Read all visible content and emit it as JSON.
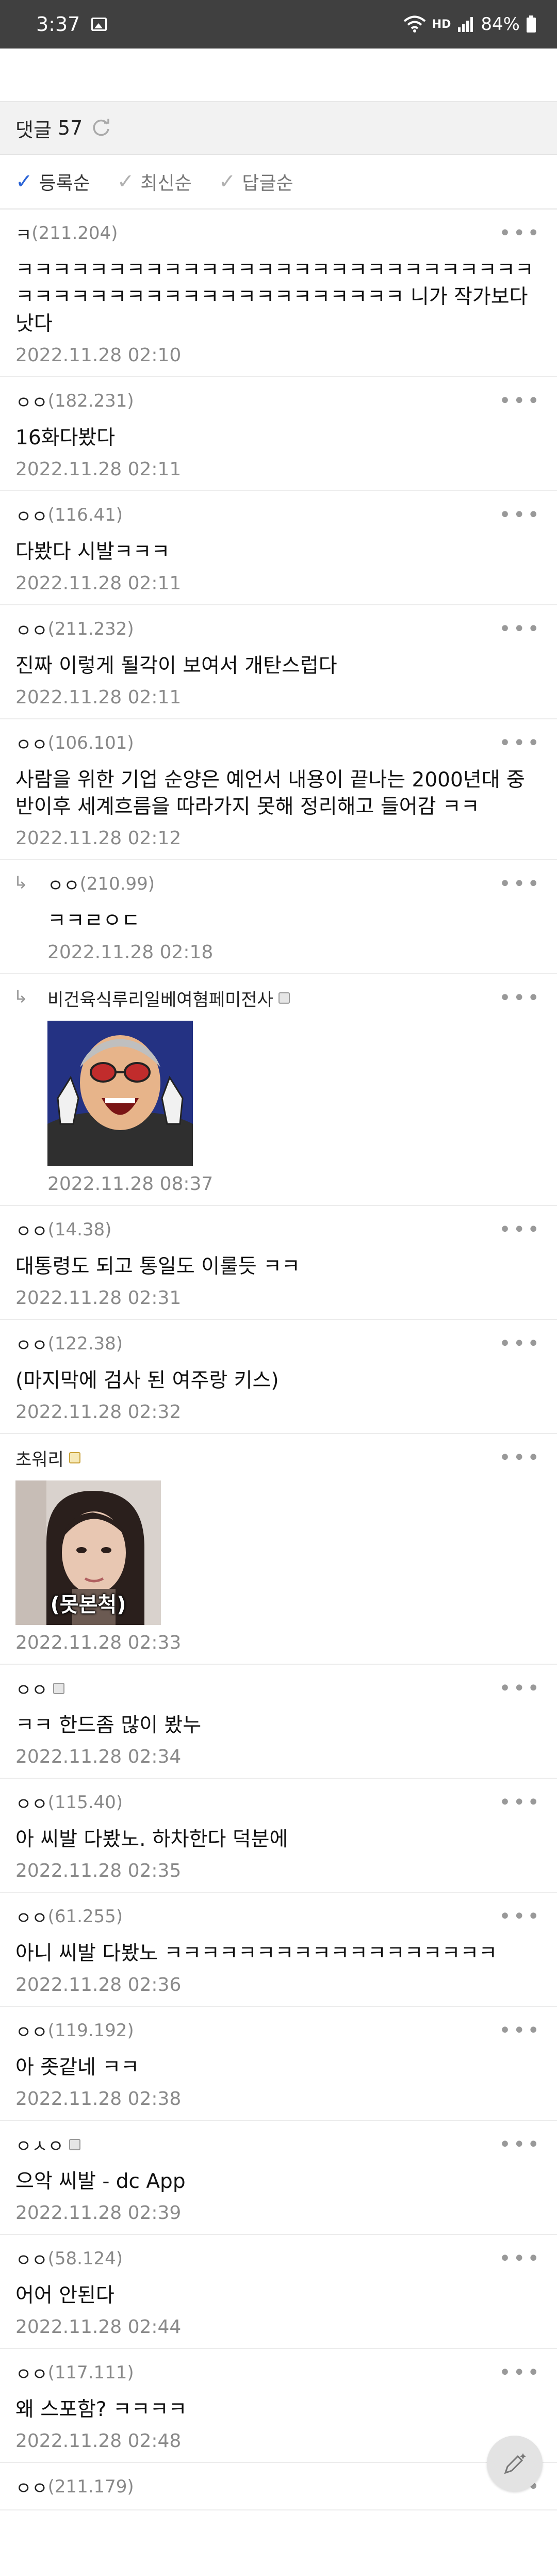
{
  "status_bar": {
    "time": "3:37",
    "network": "HD",
    "battery": "84%"
  },
  "comment_header": {
    "label": "댓글",
    "count": "57"
  },
  "sort_tabs": [
    {
      "label": "등록순",
      "active": true
    },
    {
      "label": "최신순",
      "active": false
    },
    {
      "label": "답글순",
      "active": false
    }
  ],
  "comments": [
    {
      "nick": "ㅋ",
      "ip": "(211.204)",
      "text": "ㅋㅋㅋㅋㅋㅋㅋㅋㅋㅋㅋㅋㅋㅋㅋㅋㅋㅋㅋㅋㅋㅋㅋㅋㅋㅋㅋㅋㅋㅋㅋㅋㅋㅋㅋㅋㅋㅋㅋㅋㅋㅋㅋㅋㅋㅋㅋㅋㅋ 니가 작가보다 낫다",
      "date": "2022.11.28 02:10"
    },
    {
      "nick": "ㅇㅇ",
      "ip": "(182.231)",
      "text": "16화다봤다",
      "date": "2022.11.28 02:11"
    },
    {
      "nick": "ㅇㅇ",
      "ip": "(116.41)",
      "text": "다봤다 시발ㅋㅋㅋ",
      "date": "2022.11.28 02:11"
    },
    {
      "nick": "ㅇㅇ",
      "ip": "(211.232)",
      "text": "진짜 이렇게 될각이 보여서 개탄스럽다",
      "date": "2022.11.28 02:11"
    },
    {
      "nick": "ㅇㅇ",
      "ip": "(106.101)",
      "text": "사람을 위한 기업 순양은 예언서 내용이 끝나는 2000년대 중반이후 세계흐름을 따라가지 못해 정리해고 들어감 ㅋㅋ",
      "date": "2022.11.28 02:12"
    },
    {
      "nick": "ㅇㅇ",
      "ip": "(210.99)",
      "text": "ㅋㅋㄹㅇㄷ",
      "date": "2022.11.28 02:18",
      "reply": true
    },
    {
      "nick": "비건육식루리일베여혐페미전사",
      "ip": "",
      "text": "",
      "date": "2022.11.28 08:37",
      "reply": true,
      "badge": "gray",
      "image": "cartoon-shouting-man"
    },
    {
      "nick": "ㅇㅇ",
      "ip": "(14.38)",
      "text": "대통령도 되고 통일도 이룰듯 ㅋㅋ",
      "date": "2022.11.28 02:31"
    },
    {
      "nick": "ㅇㅇ",
      "ip": "(122.38)",
      "text": "(마지막에 검사 된 여주랑 키스)",
      "date": "2022.11.28 02:32"
    },
    {
      "nick": "초워리",
      "ip": "",
      "text": "",
      "date": "2022.11.28 02:33",
      "badge": "gold",
      "image": "girl-photo",
      "image_caption": "(못본척)"
    },
    {
      "nick": "ㅇㅇ",
      "ip": "",
      "text": "ㅋㅋ 한드좀 많이 봤누",
      "date": "2022.11.28 02:34",
      "badge": "gray"
    },
    {
      "nick": "ㅇㅇ",
      "ip": "(115.40)",
      "text": "아 씨발 다봤노. 하차한다 덕분에",
      "date": "2022.11.28 02:35"
    },
    {
      "nick": "ㅇㅇ",
      "ip": "(61.255)",
      "text": "아니 씨발 다봤노 ㅋㅋㅋㅋㅋㅋㅋㅋㅋㅋㅋㅋㅋㅋㅋㅋㅋㅋ",
      "date": "2022.11.28 02:36"
    },
    {
      "nick": "ㅇㅇ",
      "ip": "(119.192)",
      "text": "아 좃같네 ㅋㅋ",
      "date": "2022.11.28 02:38"
    },
    {
      "nick": "ㅇㅅㅇ",
      "ip": "",
      "text": "으악 씨발 - dc App",
      "date": "2022.11.28 02:39",
      "badge": "gray"
    },
    {
      "nick": "ㅇㅇ",
      "ip": "(58.124)",
      "text": "어어 안된다",
      "date": "2022.11.28 02:44"
    },
    {
      "nick": "ㅇㅇ",
      "ip": "(117.111)",
      "text": "왜 스포함? ㅋㅋㅋㅋ",
      "date": "2022.11.28 02:48"
    },
    {
      "nick": "ㅇㅇ",
      "ip": "(211.179)",
      "text": "",
      "date": ""
    }
  ],
  "colors": {
    "status_bg": "#404040",
    "accent_check": "#2a63d6",
    "header_bg": "#f2f2f2"
  }
}
